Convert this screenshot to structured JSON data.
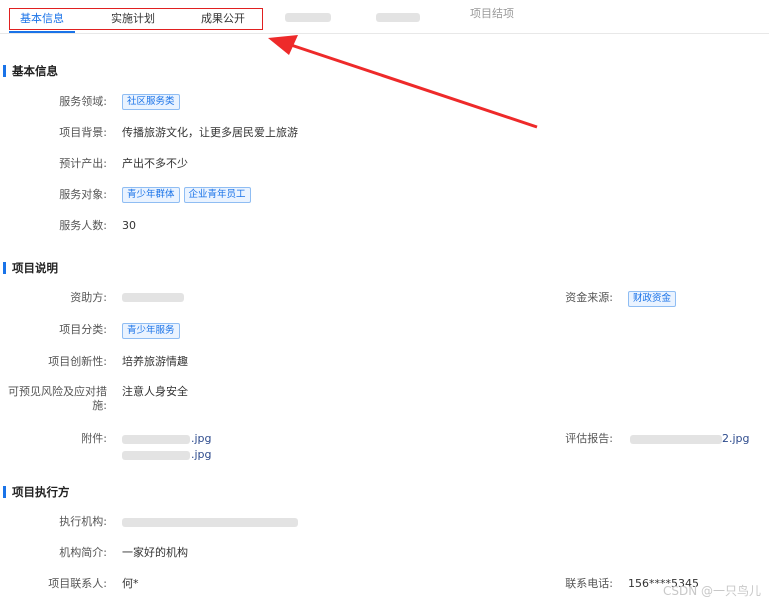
{
  "tabs": [
    {
      "label": "基本信息",
      "active": true
    },
    {
      "label": "实施计划",
      "active": false
    },
    {
      "label": "成果公开",
      "active": false
    },
    {
      "label": "项目结项",
      "active": false
    }
  ],
  "sections": {
    "basic": {
      "title": "基本信息",
      "service_field_label": "服务领域:",
      "service_field_tag": "社区服务类",
      "background_label": "项目背景:",
      "background_value": "传播旅游文化，让更多居民爱上旅游",
      "expected_output_label": "预计产出:",
      "expected_output_value": "产出不多不少",
      "service_target_label": "服务对象:",
      "service_target_tags": [
        "青少年群体",
        "企业青年员工"
      ],
      "service_count_label": "服务人数:",
      "service_count_value": "30"
    },
    "description": {
      "title": "项目说明",
      "funder_label": "资助方:",
      "fund_source_label": "资金来源:",
      "fund_source_tag": "财政资金",
      "category_label": "项目分类:",
      "category_tag": "青少年服务",
      "innovation_label": "项目创新性:",
      "innovation_value": "培养旅游情趣",
      "risk_label": "可预见风险及应对措施:",
      "risk_value": "注意人身安全",
      "attachment_label": "附件:",
      "attachment_files": [
        ".jpg",
        ".jpg"
      ],
      "evaluation_label": "评估报告:",
      "evaluation_file": "2.jpg"
    },
    "executor": {
      "title": "项目执行方",
      "org_label": "执行机构:",
      "intro_label": "机构简介:",
      "intro_value": "一家好的机构",
      "contact_label": "项目联系人:",
      "contact_value": "何*",
      "phone_label": "联系电话:",
      "phone_value": "156****5345"
    }
  },
  "watermark": "CSDN @一只鸟儿",
  "colors": {
    "accent": "#1a73e8",
    "annotation": "#e02020"
  }
}
